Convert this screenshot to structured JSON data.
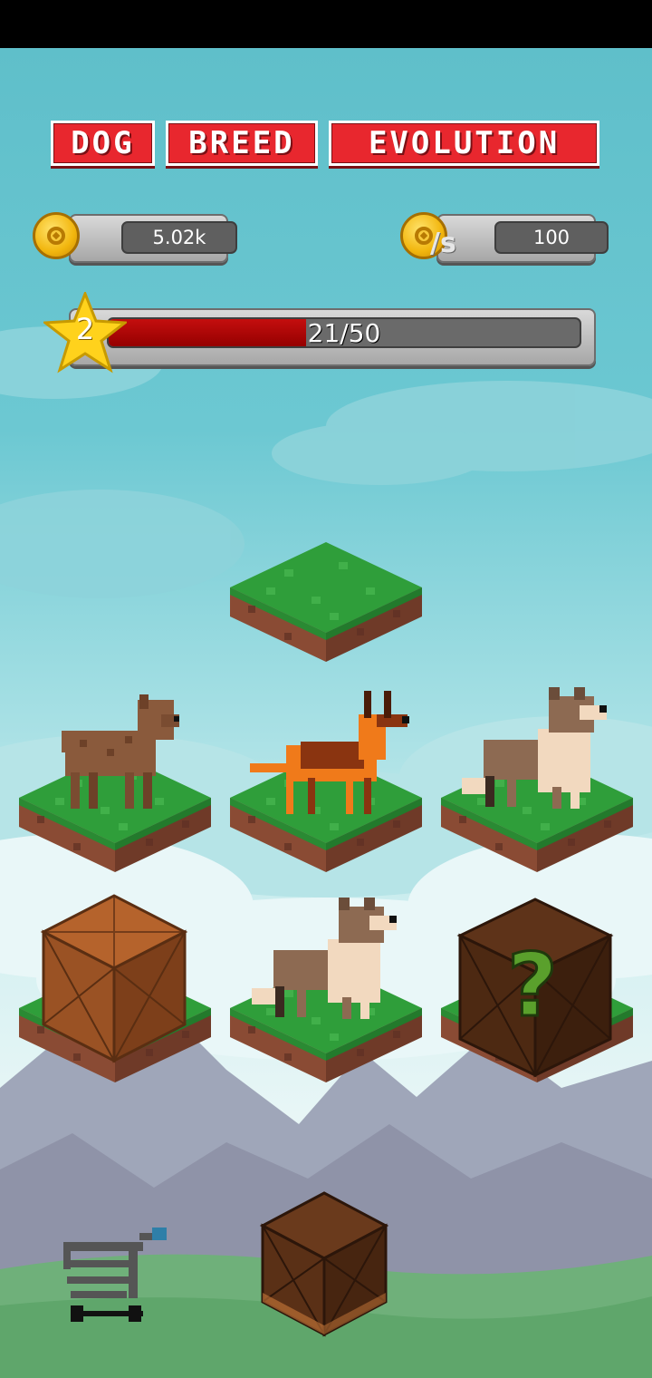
{
  "title": {
    "words": [
      "DOG",
      "BREED",
      "EVOLUTION"
    ]
  },
  "currency": {
    "coins": "5.02k",
    "income_per_second": "100"
  },
  "level": {
    "number": "2",
    "progress": "21/50",
    "progress_fraction": 0.42
  },
  "icons": {
    "coins": "gold-coin-icon",
    "income": "coin-per-second-icon",
    "level": "star-icon",
    "shop": "shopping-cart-icon"
  },
  "board": [
    {
      "slot": "top",
      "content": "empty"
    },
    {
      "slot": "middle-left",
      "content": "brown-puppy"
    },
    {
      "slot": "middle-center",
      "content": "orange-shepherd"
    },
    {
      "slot": "middle-right",
      "content": "collie"
    },
    {
      "slot": "bottom-left",
      "content": "wooden-crate"
    },
    {
      "slot": "bottom-center",
      "content": "collie"
    },
    {
      "slot": "bottom-right",
      "content": "mystery-crate"
    }
  ],
  "spawner": {
    "content": "wooden-crate"
  },
  "colors": {
    "title_red": "#e8272e",
    "progress_red": "#b30000",
    "grass": "#2f9e3a",
    "dirt": "#8a4b34",
    "crate": "#8a4a22",
    "mystery_mark": "#5aa02c"
  }
}
